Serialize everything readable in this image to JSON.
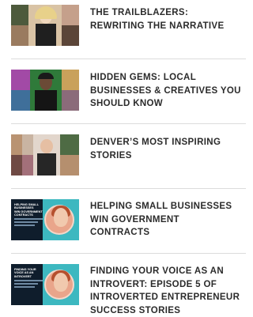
{
  "articles": [
    {
      "title": "THE TRAILBLAZERS:\nREWRITING THE NARRATIVE",
      "thumbnail": "collage-photo"
    },
    {
      "title": "HIDDEN GEMS: LOCAL\nBUSINESSES & CREATIVES YOU\nSHOULD KNOW",
      "thumbnail": "collage-photo"
    },
    {
      "title": "DENVER’S MOST INSPIRING\nSTORIES",
      "thumbnail": "collage-photo"
    },
    {
      "title": "HELPING SMALL BUSINESSES\nWIN GOVERNMENT\nCONTRACTS",
      "thumbnail": "podcast-cover",
      "cover_text": "HELPING SMALL\nBUSINESSES\nWIN GOVERNMENT\nCONTRACTS"
    },
    {
      "title": "FINDING YOUR VOICE AS AN\nINTROVERT: EPISODE 5 OF\nINTROVERTED ENTREPRENEUR\nSUCCESS STORIES",
      "thumbnail": "podcast-cover",
      "cover_text": "FINDING YOUR\nVOICE AS AN\nINTROVERT"
    }
  ],
  "colors": {
    "title_text": "#2b2b2b",
    "divider": "#dcdcdc",
    "cover_background": "#0f1d2c",
    "cover_accent": "#3db8c0"
  }
}
